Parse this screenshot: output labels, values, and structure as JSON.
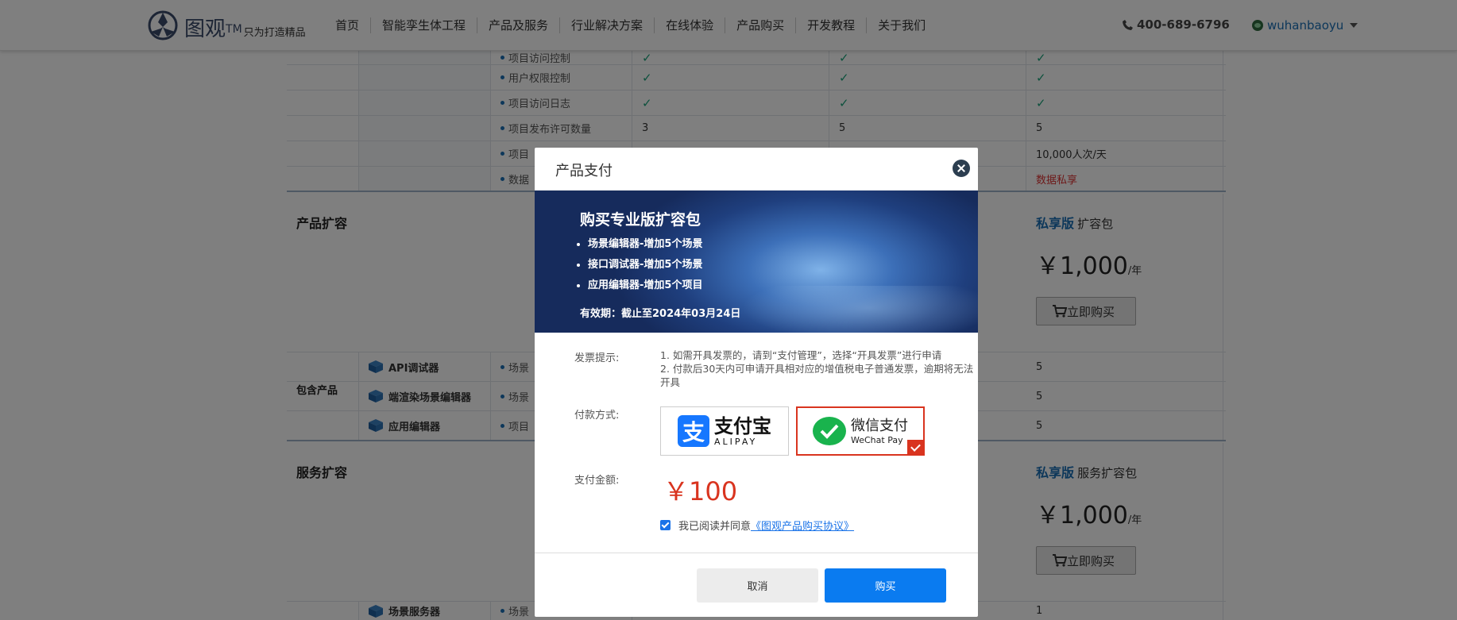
{
  "header": {
    "logo_name": "图观",
    "logo_tm": "TM",
    "logo_slogan": "只为打造精品",
    "nav": [
      "首页",
      "智能孪生体工程",
      "产品及服务",
      "行业解决方案",
      "在线体验",
      "产品购买",
      "开发教程",
      "关于我们"
    ],
    "phone": "400-689-6796",
    "username": "wuhanbaoyu"
  },
  "table": {
    "feature_rows": [
      {
        "label": "项目访问控制",
        "c1": "✓",
        "c2": "✓",
        "c3": "✓"
      },
      {
        "label": "用户权限控制",
        "c1": "✓",
        "c2": "✓",
        "c3": "✓"
      },
      {
        "label": "项目访问日志",
        "c1": "✓",
        "c2": "✓",
        "c3": "✓"
      },
      {
        "label": "项目发布许可数量",
        "c1": "3",
        "c2": "5",
        "c3": "5"
      },
      {
        "label": "项目",
        "c1": "",
        "c2": "",
        "c3": "10,000人次/天"
      },
      {
        "label": "数据",
        "c1": "",
        "c2": "",
        "c3": "数据私享"
      }
    ],
    "product_ext": {
      "title": "产品扩容",
      "plan_name": "私享版",
      "plan_suffix": "扩容包",
      "price": "￥1,000",
      "unit": "/年",
      "buy_label": "立即购买"
    },
    "included": {
      "title": "包含产品",
      "items": [
        {
          "name": "API调试器",
          "desc": "场景",
          "value": "5"
        },
        {
          "name": "端渲染场景编辑器",
          "desc": "场景",
          "value": "5"
        },
        {
          "name": "应用编辑器",
          "desc": "项目",
          "value": "5"
        }
      ]
    },
    "service_ext": {
      "title": "服务扩容",
      "plan_name": "私享版",
      "plan_suffix": "服务扩容包",
      "price": "￥1,000",
      "unit": "/年",
      "buy_label": "立即购买"
    },
    "bottom_row": {
      "name": "场景服务器",
      "desc": "场景",
      "value": "1"
    }
  },
  "modal": {
    "title": "产品支付",
    "banner": {
      "title": "购买专业版扩容包",
      "items": [
        "场景编辑器-增加5个场景",
        "接口调试器-增加5个场景",
        "应用编辑器-增加5个项目"
      ],
      "validity": "有效期：截止至2024年03月24日"
    },
    "invoice_label": "发票提示:",
    "invoice_notes": [
      "1. 如需开具发票的，请到“支付管理”，选择“开具发票”进行申请",
      "2. 付款后30天内可申请开具相对应的增值税电子普通发票，逾期将无法开具"
    ],
    "payment_label": "付款方式:",
    "alipay": {
      "glyph": "支",
      "name": "支付宝",
      "sub": "ALIPAY"
    },
    "wechat": {
      "name": "微信支付",
      "sub": "WeChat Pay",
      "selected": true
    },
    "amount_label": "支付金额:",
    "amount": "￥100",
    "agree_text": "我已阅读并同意",
    "agree_link": "《图观产品购买协议》",
    "cancel_label": "取消",
    "buy_label": "购买"
  }
}
